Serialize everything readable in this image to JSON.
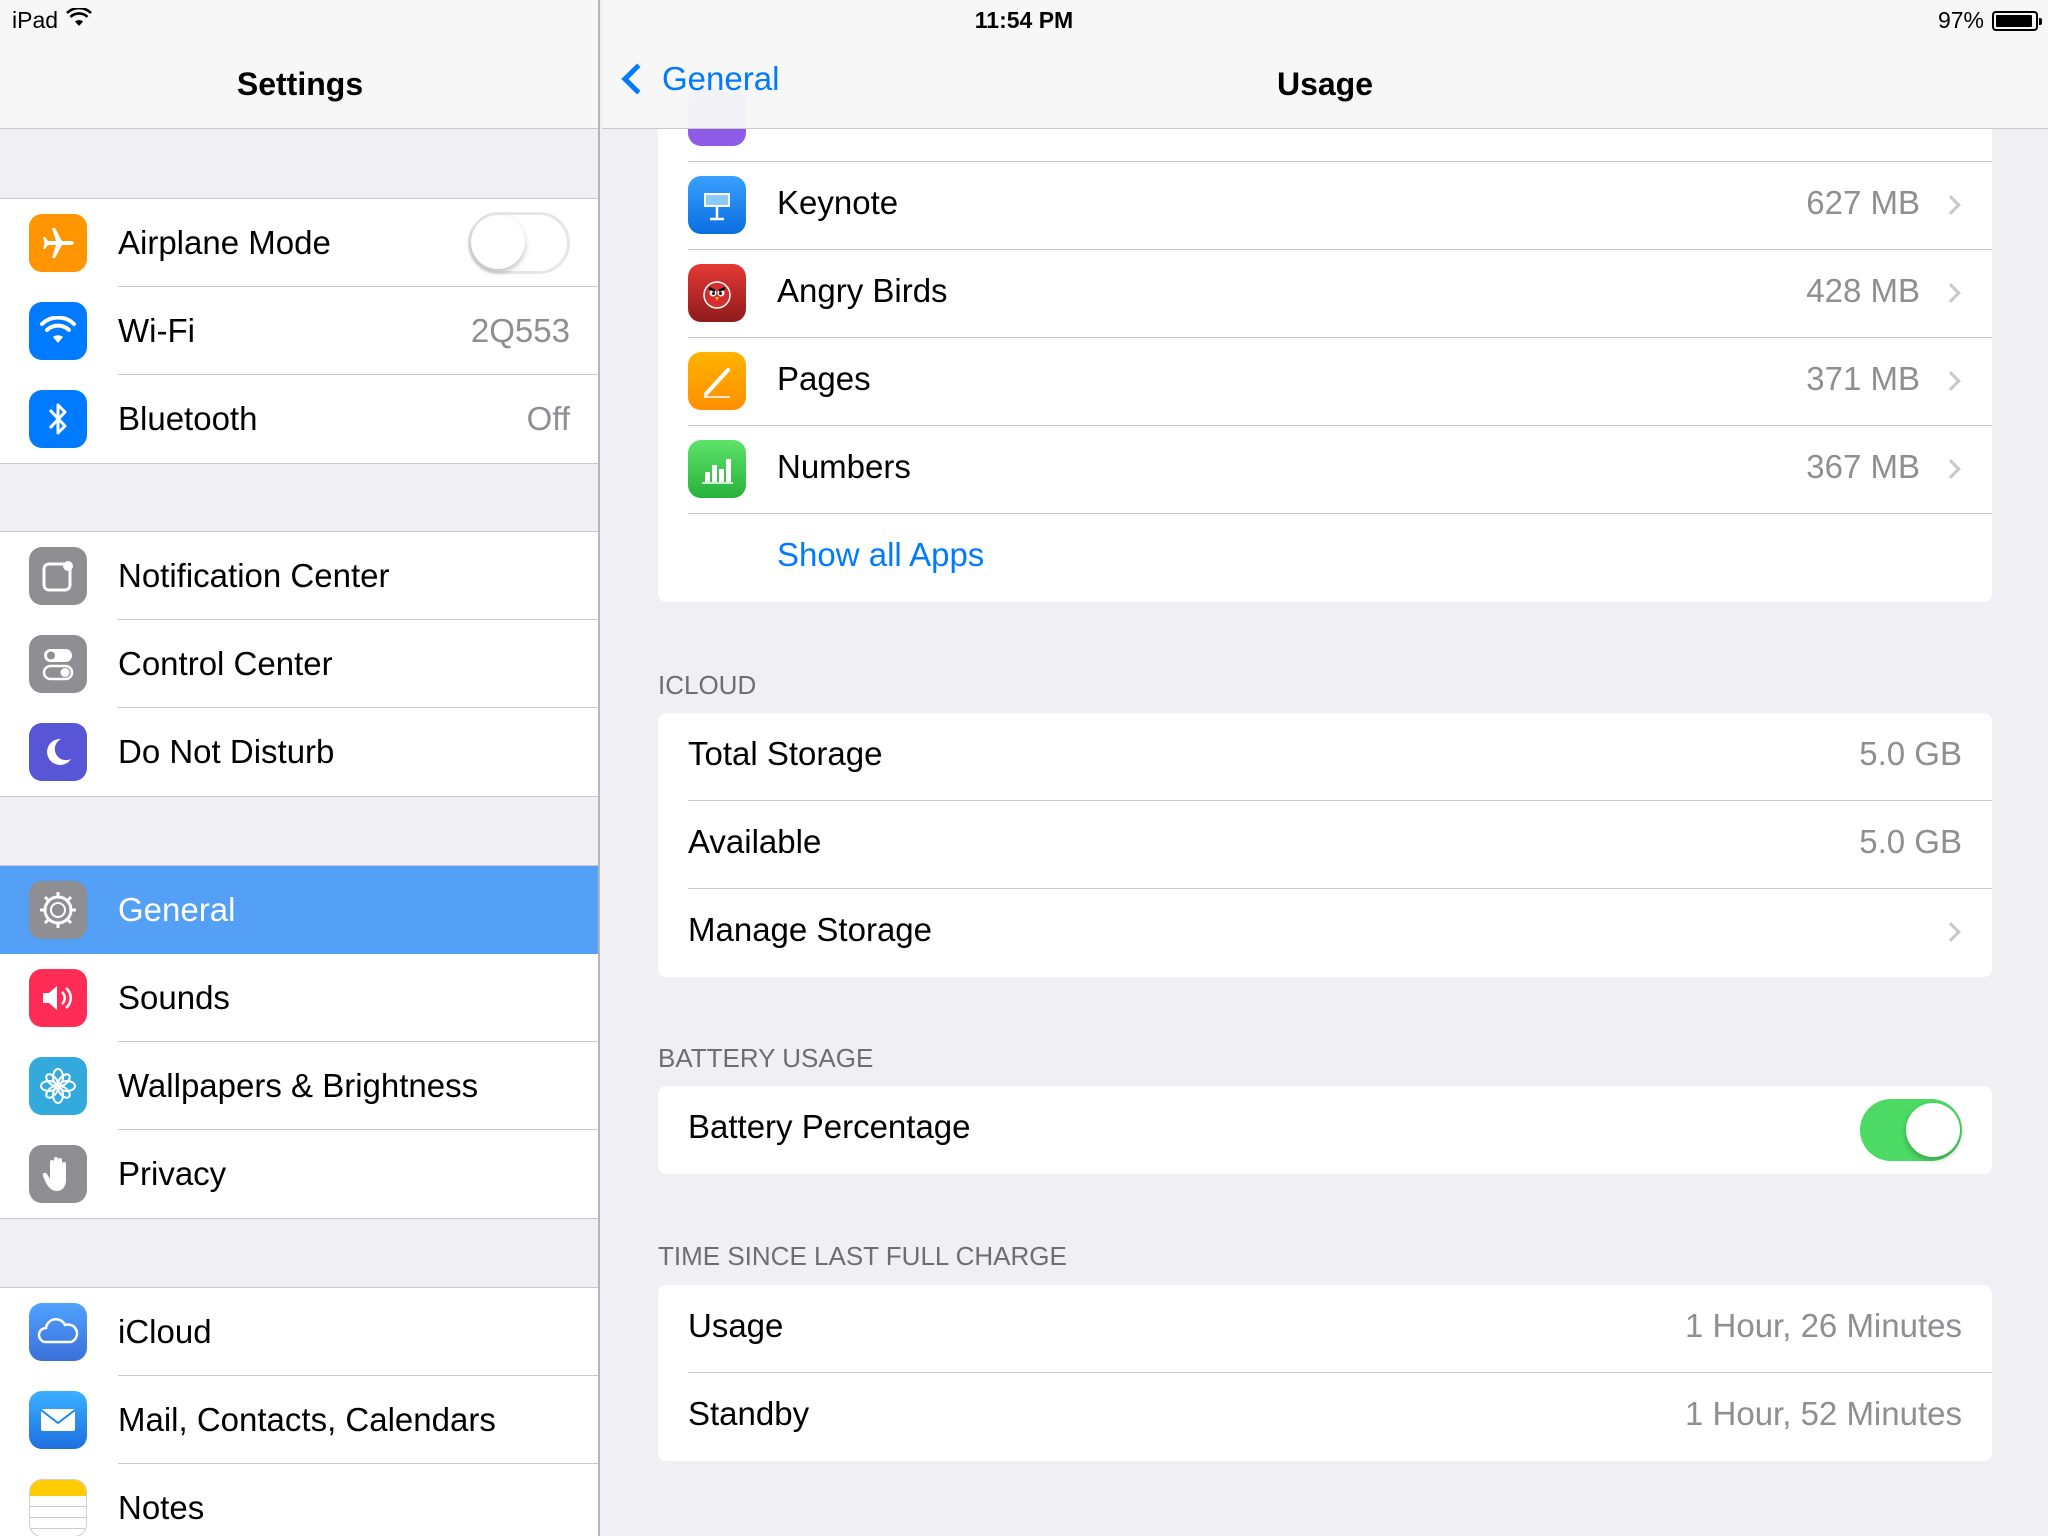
{
  "status_bar": {
    "device": "iPad",
    "time": "11:54 PM",
    "battery_percent": "97%"
  },
  "master": {
    "title": "Settings",
    "groups": [
      [
        {
          "label": "Airplane Mode",
          "icon": "airplane-icon",
          "color": "#ff9500",
          "toggle": "off"
        },
        {
          "label": "Wi-Fi",
          "value": "2Q553",
          "icon": "wifi-icon",
          "color": "#007aff"
        },
        {
          "label": "Bluetooth",
          "value": "Off",
          "icon": "bluetooth-icon",
          "color": "#007aff"
        }
      ],
      [
        {
          "label": "Notification Center",
          "icon": "notification-center-icon",
          "color": "#8e8e93"
        },
        {
          "label": "Control Center",
          "icon": "control-center-icon",
          "color": "#8e8e93"
        },
        {
          "label": "Do Not Disturb",
          "icon": "moon-icon",
          "color": "#5856d6"
        }
      ],
      [
        {
          "label": "General",
          "icon": "gear-icon",
          "color": "#8e8e93",
          "selected": true
        },
        {
          "label": "Sounds",
          "icon": "speaker-icon",
          "color": "#ff2d55"
        },
        {
          "label": "Wallpapers & Brightness",
          "icon": "flower-icon",
          "color": "#34aadc"
        },
        {
          "label": "Privacy",
          "icon": "hand-icon",
          "color": "#8e8e93"
        }
      ],
      [
        {
          "label": "iCloud",
          "icon": "cloud-icon",
          "color": "#4a90e2"
        },
        {
          "label": "Mail, Contacts, Calendars",
          "icon": "envelope-icon",
          "color": "#1e88e5"
        },
        {
          "label": "Notes",
          "icon": "notes-icon",
          "color": "#ffcc00"
        }
      ]
    ]
  },
  "detail": {
    "back_label": "General",
    "title": "Usage",
    "apps": [
      {
        "name": "Keynote",
        "size": "627 MB",
        "icon": "keynote-icon",
        "color": "#1a8cff"
      },
      {
        "name": "Angry Birds",
        "size": "428 MB",
        "icon": "angry-birds-icon",
        "color": "#c62828"
      },
      {
        "name": "Pages",
        "size": "371 MB",
        "icon": "pages-icon",
        "color": "#ff9500"
      },
      {
        "name": "Numbers",
        "size": "367 MB",
        "icon": "numbers-icon",
        "color": "#4cd964"
      }
    ],
    "show_all_apps": "Show all Apps",
    "icloud": {
      "header": "ICLOUD",
      "total_storage_label": "Total Storage",
      "total_storage_value": "5.0 GB",
      "available_label": "Available",
      "available_value": "5.0 GB",
      "manage_label": "Manage Storage"
    },
    "battery": {
      "header": "BATTERY USAGE",
      "percentage_label": "Battery Percentage",
      "percentage_toggle": "on"
    },
    "time_since": {
      "header": "TIME SINCE LAST FULL CHARGE",
      "usage_label": "Usage",
      "usage_value": "1 Hour, 26 Minutes",
      "standby_label": "Standby",
      "standby_value": "1 Hour, 52 Minutes"
    }
  }
}
